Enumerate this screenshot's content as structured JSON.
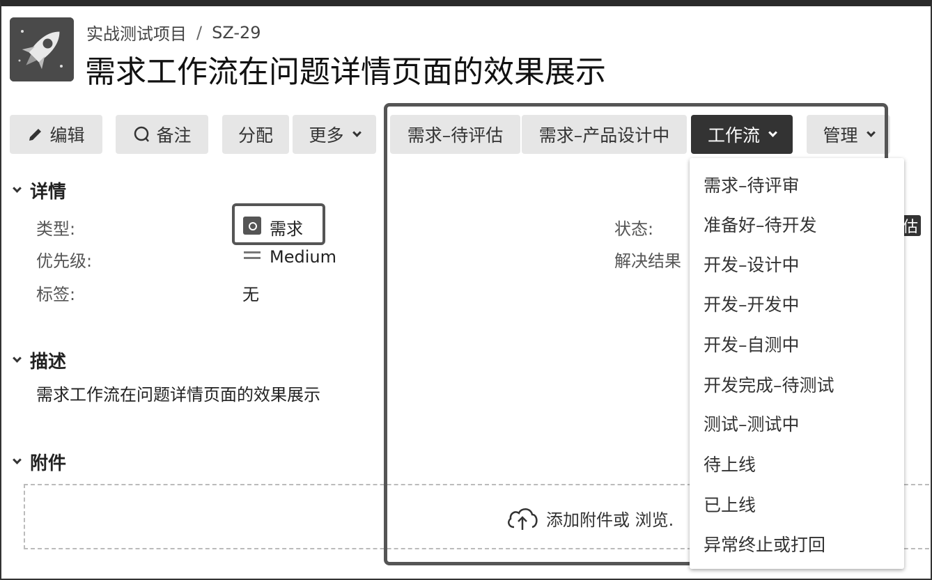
{
  "breadcrumb": {
    "project": "实战测试项目",
    "separator": "/",
    "issue_key": "SZ-29"
  },
  "title": "需求工作流在问题详情页面的效果展示",
  "toolbar": {
    "edit": "编辑",
    "comment": "备注",
    "assign": "分配",
    "more": "更多",
    "transition_1": "需求–待评估",
    "transition_2": "需求–产品设计中",
    "workflow": "工作流",
    "admin": "管理"
  },
  "details": {
    "heading": "详情",
    "type_label": "类型:",
    "type_value": "需求",
    "priority_label": "优先级:",
    "priority_value": "Medium",
    "labels_label": "标签:",
    "labels_value": "无",
    "status_label": "状态:",
    "status_value_fragment": "估",
    "resolution_label": "解决结果"
  },
  "description": {
    "heading": "描述",
    "text": "需求工作流在问题详情页面的效果展示"
  },
  "attachments": {
    "heading": "附件",
    "upload_text": "添加附件或 浏览."
  },
  "workflow_menu": [
    "需求–待评审",
    "准备好–待开发",
    "开发–设计中",
    "开发–开发中",
    "开发–自测中",
    "开发完成–待测试",
    "测试–测试中",
    "待上线",
    "已上线",
    "异常终止或打回"
  ],
  "icons": [
    "rocket-icon",
    "pencil-icon",
    "comment-icon",
    "chevron-down-icon",
    "issue-type-icon",
    "priority-medium-icon",
    "upload-cloud-icon"
  ]
}
